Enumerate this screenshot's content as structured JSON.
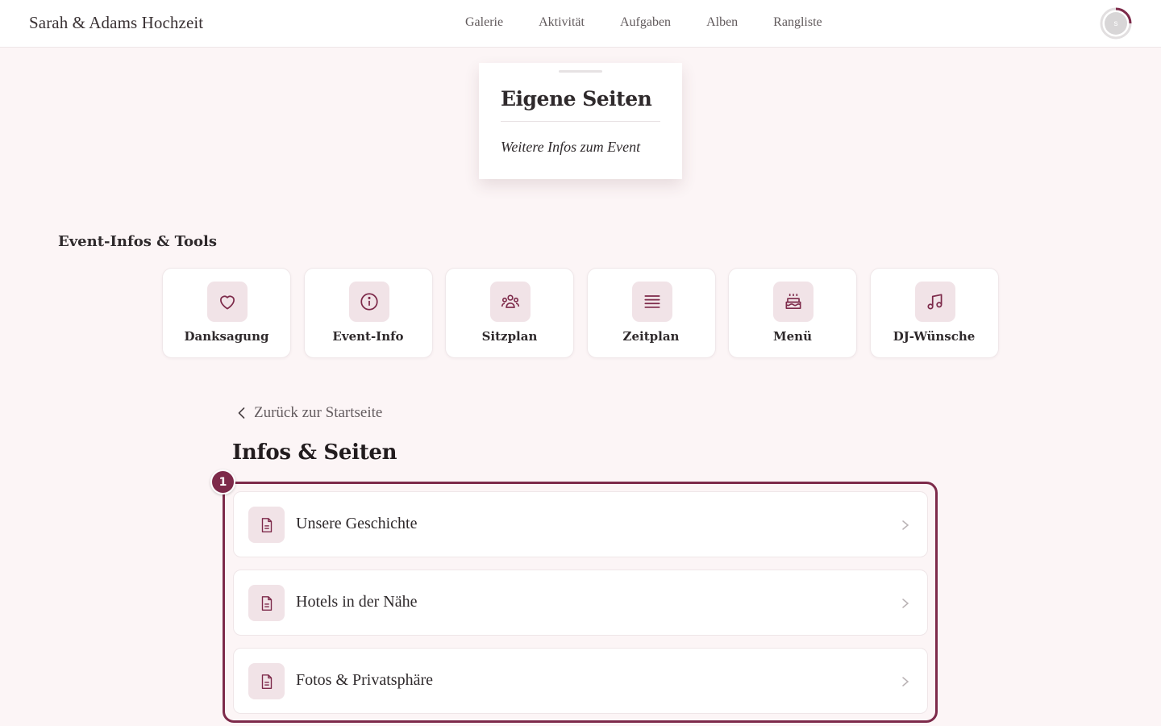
{
  "header": {
    "brand": "Sarah & Adams Hochzeit",
    "nav": [
      "Galerie",
      "Aktivität",
      "Aufgaben",
      "Alben",
      "Rangliste"
    ],
    "avatar_initial": "s"
  },
  "top_card": {
    "title": "Eigene Seiten",
    "subtitle": "Weitere Infos zum Event"
  },
  "tools_section": {
    "title": "Event-Infos & Tools",
    "items": [
      {
        "label": "Danksagung",
        "icon": "heart-icon"
      },
      {
        "label": "Event-Info",
        "icon": "info-icon"
      },
      {
        "label": "Sitzplan",
        "icon": "people-icon"
      },
      {
        "label": "Zeitplan",
        "icon": "list-icon"
      },
      {
        "label": "Menü",
        "icon": "cake-icon"
      },
      {
        "label": "DJ-Wünsche",
        "icon": "music-icon"
      }
    ]
  },
  "back_link": "Zurück zur Startseite",
  "page_title": "Infos & Seiten",
  "highlight_badge": "1",
  "pages": [
    {
      "label": "Unsere Geschichte",
      "icon": "document-icon"
    },
    {
      "label": "Hotels in der Nähe",
      "icon": "document-icon"
    },
    {
      "label": "Fotos & Privatsphäre",
      "icon": "document-icon"
    }
  ],
  "colors": {
    "accent": "#7d2a4a",
    "icon_bg": "#f1e3e7",
    "page_bg": "#fcf5f6"
  }
}
